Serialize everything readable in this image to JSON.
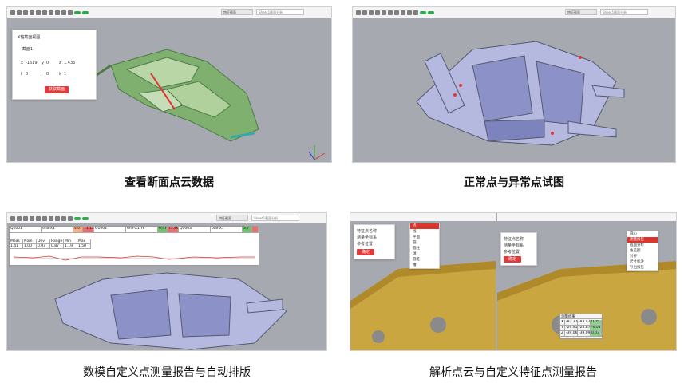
{
  "panels": [
    {
      "id": "p1",
      "caption": "查看断面点云数据",
      "toolbar": {
        "tag": "特征截面",
        "search": "Sheet1截面分析"
      },
      "dialog": {
        "title": "X轴截面视图",
        "section": "截面1",
        "fields": [
          {
            "label": "x",
            "value": "-1619"
          },
          {
            "label": "y",
            "value": "0"
          },
          {
            "label": "z",
            "value": "1.436"
          },
          {
            "label": "i",
            "value": "0"
          },
          {
            "label": "j",
            "value": "0"
          },
          {
            "label": "k",
            "value": "1"
          }
        ],
        "button": "获取截面"
      }
    },
    {
      "id": "p2",
      "caption": "正常点与异常点试图",
      "toolbar": {
        "tag": "特征截面",
        "search": "Sheet1截面分析"
      }
    },
    {
      "id": "p3",
      "caption": "数模自定义点测量报告与自动排版",
      "toolbar": {
        "tag": "特征截面",
        "search": "Sheet1截面分析"
      },
      "report_groups": [
        {
          "id": "Q1001",
          "sub": "0fix-X1",
          "status": "4.0",
          "flag": "T1.15"
        },
        {
          "id": "Q1002",
          "sub": "0fix-X1 TF",
          "status": "0.47",
          "flag": "T1.46"
        },
        {
          "id": "Q1003",
          "sub": "0fix-X1",
          "status": "3.7",
          "flag": ""
        }
      ],
      "report_headers": [
        "Meas",
        "Nom",
        "Dev",
        "Range",
        "Min",
        "Max"
      ],
      "report_values": [
        "1.41",
        "1.00",
        "0.07",
        "0.87",
        "1.19",
        "1.50"
      ]
    },
    {
      "id": "p4",
      "caption": "解析点云与自定义特征点测量报告",
      "left_dialog": {
        "items": [
          "特征点名称",
          "测量坐标系",
          "参考位置"
        ],
        "button": "确定"
      },
      "left_menu": [
        "点",
        "线",
        "平面",
        "圆",
        "圆柱",
        "球",
        "圆锥",
        "槽"
      ],
      "right_dialog": {
        "items": [
          "特征点名称",
          "测量坐标系",
          "参考位置"
        ],
        "button": "确定"
      },
      "right_menu": [
        "圆心",
        "测量报告",
        "截面分析",
        "色差图",
        "对齐",
        "尺寸标注",
        "导出报告"
      ],
      "result_box": {
        "title": "测量结果",
        "rows": [
          [
            "X",
            "-83.37",
            "-83.42",
            "0.05"
          ],
          [
            "Y",
            "-20.91",
            "-20.87",
            "-0.04"
          ],
          [
            "Z",
            "-39.06",
            "-39.09",
            "0.03"
          ]
        ]
      }
    }
  ],
  "colors": {
    "viewport_gray": "#a9adb3",
    "part_blue": "#a9aede",
    "mesh_yellow": "#c9a640",
    "accent_red": "#e03a3a"
  }
}
